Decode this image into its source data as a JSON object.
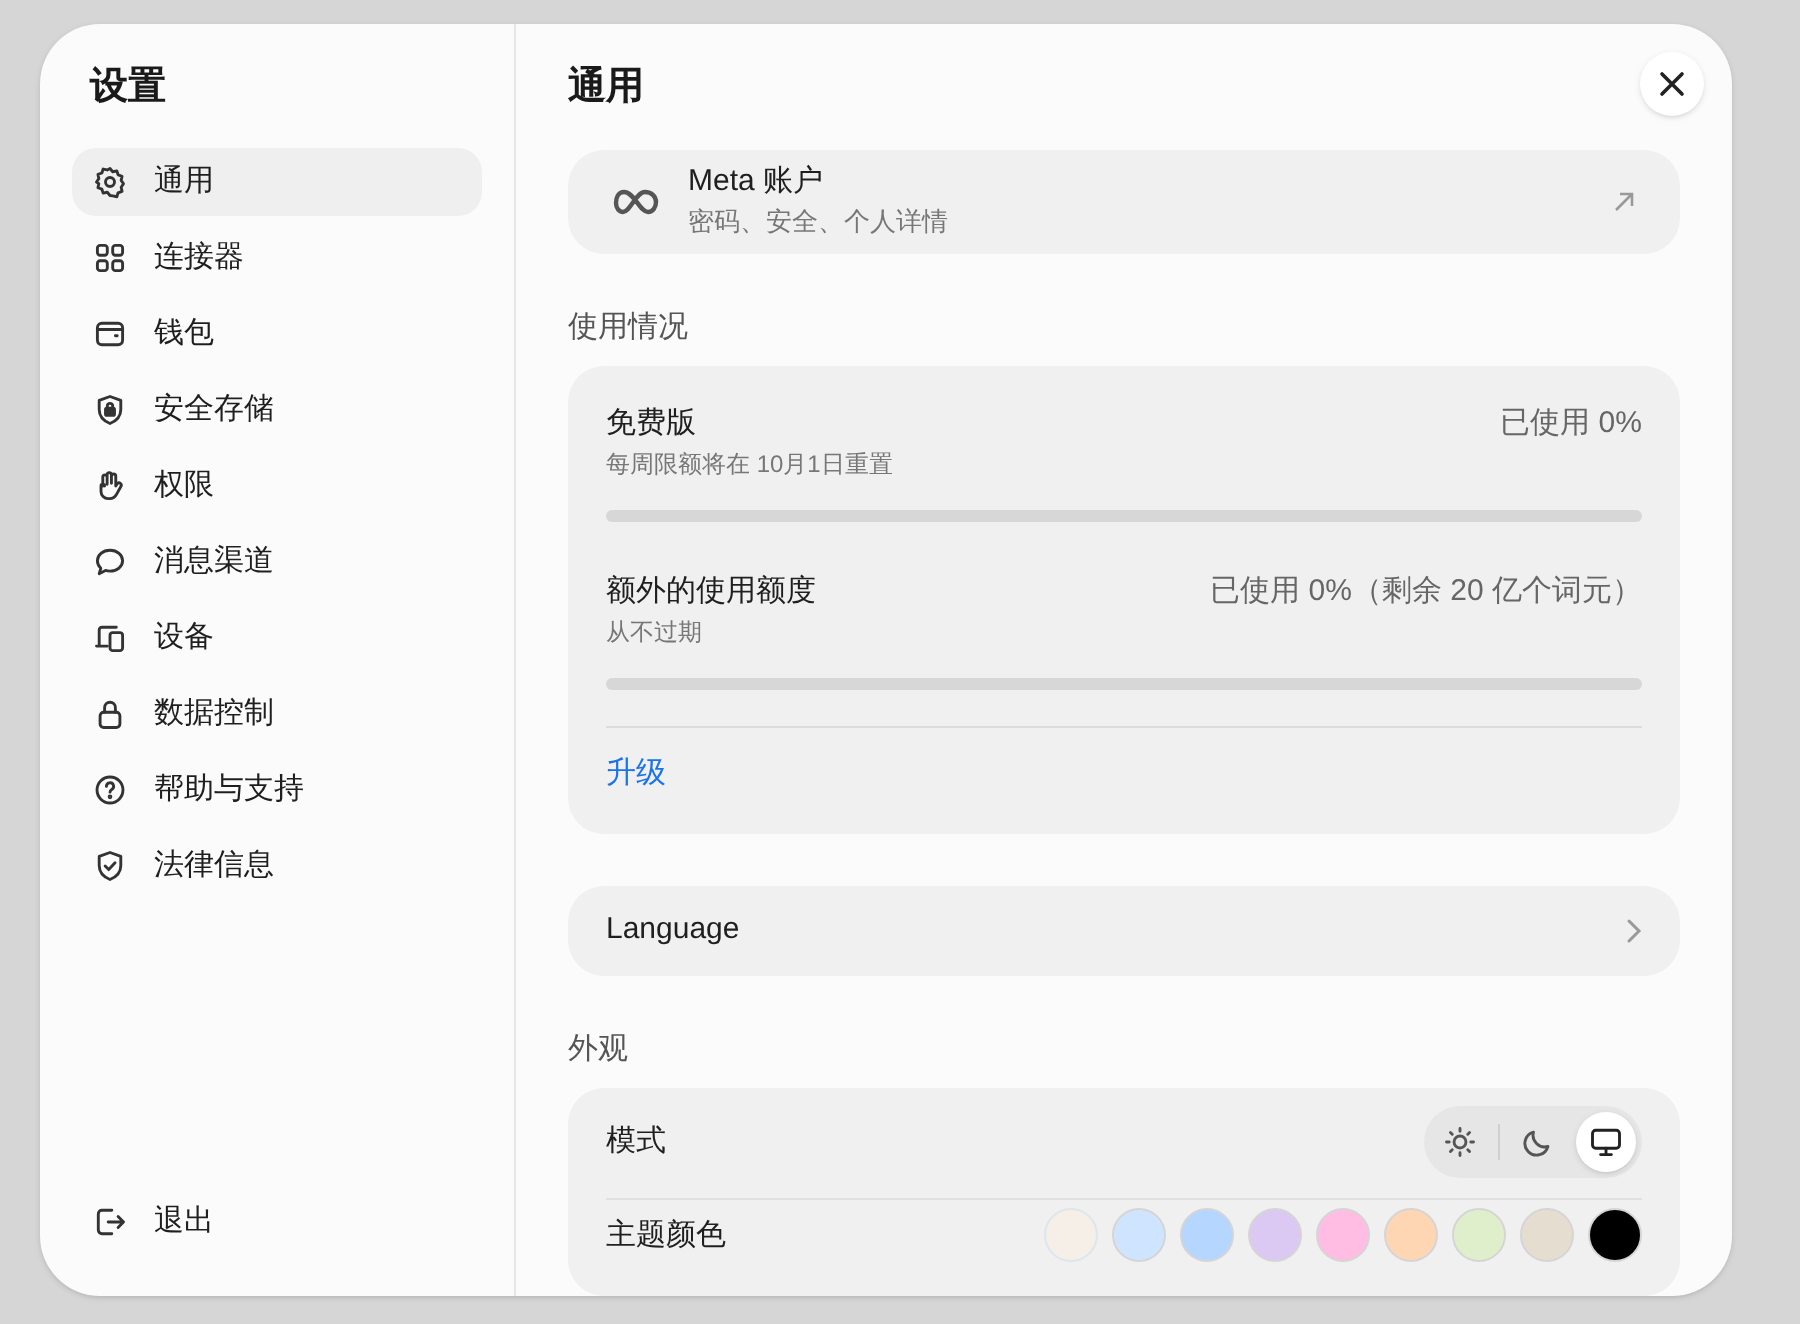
{
  "sidebar": {
    "title": "设置",
    "items": [
      {
        "label": "通用",
        "selected": true
      },
      {
        "label": "连接器",
        "selected": false
      },
      {
        "label": "钱包",
        "selected": false
      },
      {
        "label": "安全存储",
        "selected": false
      },
      {
        "label": "权限",
        "selected": false
      },
      {
        "label": "消息渠道",
        "selected": false
      },
      {
        "label": "设备",
        "selected": false
      },
      {
        "label": "数据控制",
        "selected": false
      },
      {
        "label": "帮助与支持",
        "selected": false
      },
      {
        "label": "法律信息",
        "selected": false
      }
    ],
    "logout": {
      "label": "退出"
    }
  },
  "main": {
    "title": "通用",
    "account": {
      "title": "Meta 账户",
      "subtitle": "密码、安全、个人详情"
    },
    "usage": {
      "heading": "使用情况",
      "meters": [
        {
          "name": "免费版",
          "note": "每周限额将在 10月1日重置",
          "reading": "已使用 0%",
          "level": 0
        },
        {
          "name": "额外的使用额度",
          "note": "从不过期",
          "reading": "已使用 0%（剩余 20 亿个词元）",
          "level": 0
        }
      ],
      "upgrade": "升级"
    },
    "language": {
      "label": "Language"
    },
    "appearance": {
      "heading": "外观",
      "mode": {
        "label": "模式",
        "options": [
          {
            "selected": false
          },
          {
            "selected": false
          },
          {
            "selected": true
          }
        ]
      },
      "theme": {
        "label": "主题颜色",
        "swatches": [
          {
            "kind": "picture",
            "selected": false
          },
          {
            "kind": "color",
            "color": "#cfe5ff",
            "selected": false
          },
          {
            "kind": "color",
            "color": "#b5d6ff",
            "selected": false
          },
          {
            "kind": "color",
            "color": "#dcc9f3",
            "selected": false
          },
          {
            "kind": "color",
            "color": "#ffbde3",
            "selected": false
          },
          {
            "kind": "color",
            "color": "#ffd6b3",
            "selected": false
          },
          {
            "kind": "color",
            "color": "#e0efcb",
            "selected": false
          },
          {
            "kind": "color",
            "color": "#e6ddd1",
            "selected": false
          },
          {
            "kind": "color",
            "color": "#000000",
            "selected": false
          }
        ]
      }
    }
  }
}
